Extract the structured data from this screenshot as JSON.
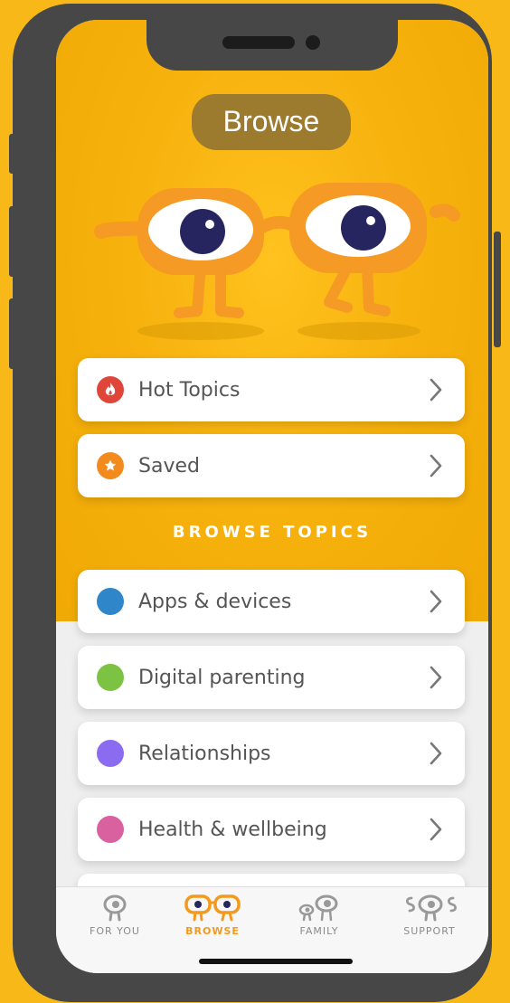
{
  "header": {
    "title": "Browse"
  },
  "quick_links": [
    {
      "label": "Hot Topics",
      "icon": "flame-icon",
      "color": "#E0453A"
    },
    {
      "label": "Saved",
      "icon": "star-icon",
      "color": "#F28A1E"
    }
  ],
  "section": {
    "heading": "BROWSE TOPICS"
  },
  "topics": [
    {
      "label": "Apps & devices",
      "color": "#2F86C9"
    },
    {
      "label": "Digital parenting",
      "color": "#7CC243"
    },
    {
      "label": "Relationships",
      "color": "#8B6CF0"
    },
    {
      "label": "Health & wellbeing",
      "color": "#D9619F"
    }
  ],
  "tabbar": {
    "tabs": [
      {
        "label": "FOR YOU",
        "active": false
      },
      {
        "label": "BROWSE",
        "active": true
      },
      {
        "label": "FAMILY",
        "active": false
      },
      {
        "label": "SUPPORT",
        "active": false
      }
    ]
  },
  "colors": {
    "background": "#F8B918",
    "accent": "#F39A1E",
    "phone_frame": "#474747"
  }
}
